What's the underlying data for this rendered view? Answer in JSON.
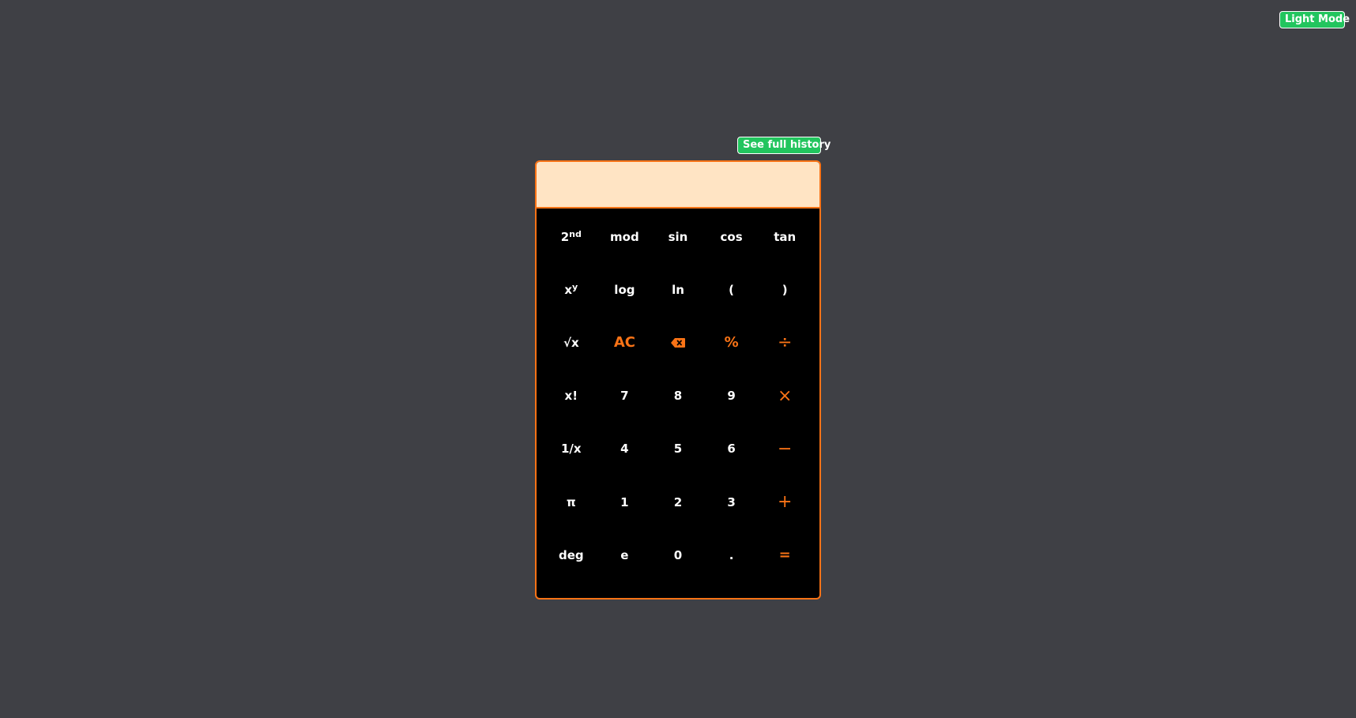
{
  "top_button": {
    "label": "Light Mode"
  },
  "history_button": {
    "label": "See full history"
  },
  "display": {
    "value": ""
  },
  "keys": {
    "second": {
      "base": "2",
      "sup": "nd"
    },
    "mod": "mod",
    "sin": "sin",
    "cos": "cos",
    "tan": "tan",
    "power": {
      "base": "x",
      "sup": "y"
    },
    "log": "log",
    "ln": "ln",
    "open_paren": "(",
    "close_paren": ")",
    "sqrt": "√x",
    "ac": "AC",
    "backspace_icon": "backspace-icon",
    "percent": "%",
    "divide": "÷",
    "factorial": "x!",
    "seven": "7",
    "eight": "8",
    "nine": "9",
    "multiply": "×",
    "reciprocal": "1/x",
    "four": "4",
    "five": "5",
    "six": "6",
    "minus": "−",
    "pi": "π",
    "one": "1",
    "two": "2",
    "three": "3",
    "plus": "+",
    "deg": "deg",
    "e": "e",
    "zero": "0",
    "dot": ".",
    "equals": "="
  },
  "colors": {
    "background": "#3f4045",
    "accent": "#f97316",
    "button_green": "#22c55e",
    "display_bg": "#ffe4c4",
    "keypad_bg": "#000000"
  }
}
